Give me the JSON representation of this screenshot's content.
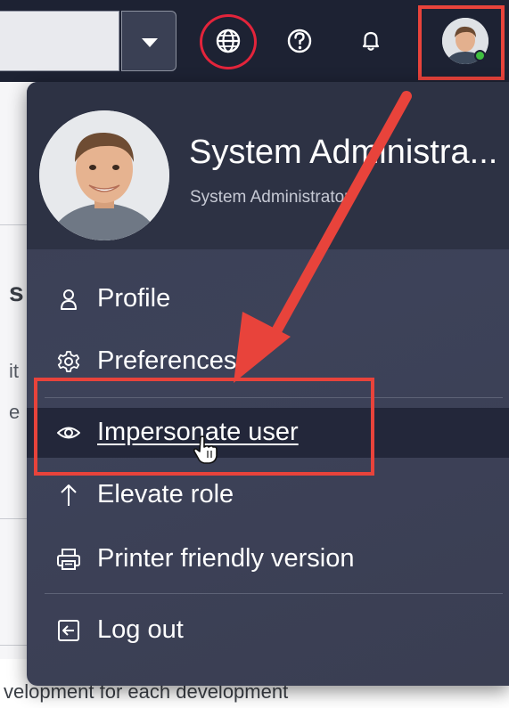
{
  "topbar": {
    "icons": [
      "chevron-down-icon",
      "globe-icon",
      "help-icon",
      "bell-icon"
    ]
  },
  "user": {
    "name": "System Administra...",
    "role": "System Administrator",
    "status_color": "#3fbf3f"
  },
  "menu": {
    "items": [
      {
        "label": "Profile",
        "icon": "user-icon"
      },
      {
        "label": "Preferences",
        "icon": "gear-icon"
      },
      {
        "label": "Impersonate user",
        "icon": "eye-icon"
      },
      {
        "label": "Elevate role",
        "icon": "arrow-up-icon"
      },
      {
        "label": "Printer friendly version",
        "icon": "printer-icon"
      },
      {
        "label": "Log out",
        "icon": "logout-icon"
      }
    ],
    "active_item": "Impersonate user"
  },
  "background": {
    "fragments": [
      "s",
      "it",
      "e"
    ],
    "bottom_text": "velopment  for each development"
  },
  "colors": {
    "header_bg": "#1d2233",
    "menu_bg": "#3a3f54",
    "annotation": "#e8433b"
  }
}
